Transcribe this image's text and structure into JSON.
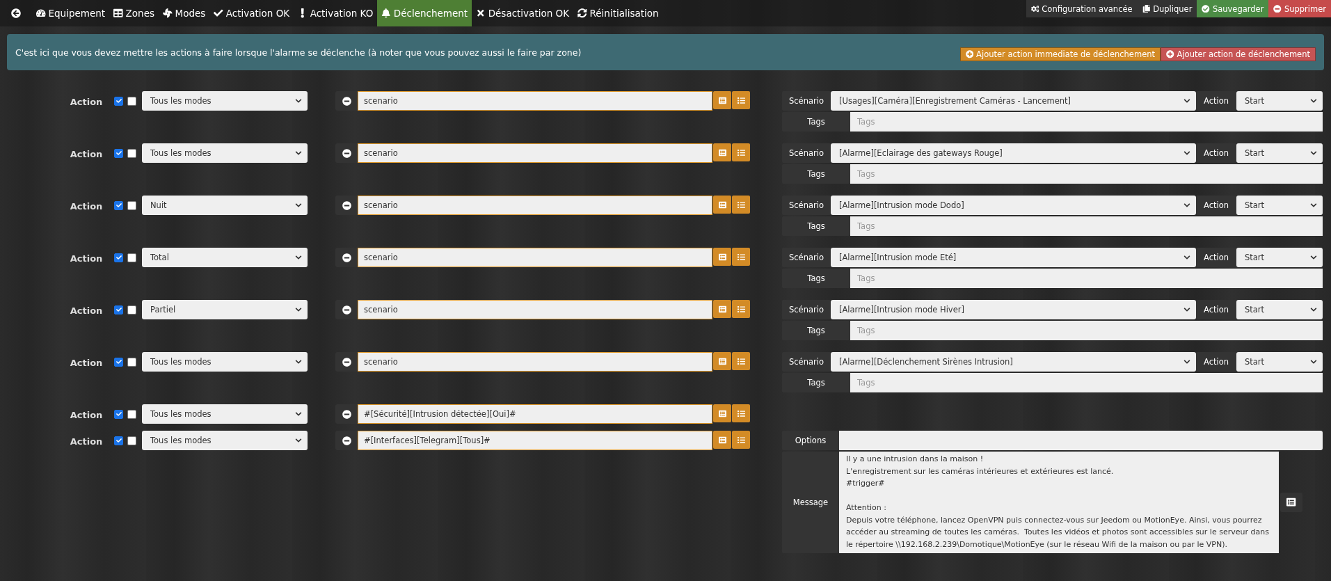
{
  "nav": {
    "tabs": [
      {
        "label": "Equipement",
        "selected": false
      },
      {
        "label": "Zones",
        "selected": false
      },
      {
        "label": "Modes",
        "selected": false
      },
      {
        "label": "Activation OK",
        "selected": false
      },
      {
        "label": "Activation KO",
        "selected": false
      },
      {
        "label": "Déclenchement",
        "selected": true
      },
      {
        "label": "Désactivation OK",
        "selected": false
      },
      {
        "label": "Réinitialisation",
        "selected": false
      }
    ],
    "buttons": [
      {
        "label": "Configuration avancée",
        "kind": "config"
      },
      {
        "label": "Dupliquer",
        "kind": "copy"
      },
      {
        "label": "Sauvegarder",
        "kind": "save"
      },
      {
        "label": "Supprimer",
        "kind": "delete"
      }
    ]
  },
  "info": {
    "text": "C'est ici que vous devez mettre les actions à faire lorsque l'alarme se déclenche (à noter que vous pouvez aussi le faire par zone)",
    "buttons": [
      {
        "label": "Ajouter action immediate de déclenchement",
        "kind": "orange"
      },
      {
        "label": "Ajouter action de déclenchement",
        "kind": "red"
      }
    ]
  },
  "actions": [
    {
      "kind": "scenario",
      "label": "Action",
      "checkboxes": [
        {
          "checked": true
        },
        {
          "checked": false
        }
      ],
      "mode": "Tous les modes",
      "command": "scenario",
      "scenario_label": "Scénario",
      "scenario": "[Usages][Caméra][Enregistrement Caméras - Lancement]",
      "action_label": "Action",
      "action": "Start",
      "tags_label": "Tags",
      "tags_placeholder": "Tags"
    },
    {
      "kind": "scenario",
      "label": "Action",
      "checkboxes": [
        {
          "checked": true
        },
        {
          "checked": false
        }
      ],
      "mode": "Tous les modes",
      "command": "scenario",
      "scenario_label": "Scénario",
      "scenario": "[Alarme][Eclairage des gateways Rouge]",
      "action_label": "Action",
      "action": "Start",
      "tags_label": "Tags",
      "tags_placeholder": "Tags"
    },
    {
      "kind": "scenario",
      "label": "Action",
      "checkboxes": [
        {
          "checked": true
        },
        {
          "checked": false
        }
      ],
      "mode": "Nuit",
      "command": "scenario",
      "scenario_label": "Scénario",
      "scenario": "[Alarme][Intrusion mode Dodo]",
      "action_label": "Action",
      "action": "Start",
      "tags_label": "Tags",
      "tags_placeholder": "Tags"
    },
    {
      "kind": "scenario",
      "label": "Action",
      "checkboxes": [
        {
          "checked": true
        },
        {
          "checked": false
        }
      ],
      "mode": "Total",
      "command": "scenario",
      "scenario_label": "Scénario",
      "scenario": "[Alarme][Intrusion mode Eté]",
      "action_label": "Action",
      "action": "Start",
      "tags_label": "Tags",
      "tags_placeholder": "Tags"
    },
    {
      "kind": "scenario",
      "label": "Action",
      "checkboxes": [
        {
          "checked": true
        },
        {
          "checked": false
        }
      ],
      "mode": "Partiel",
      "command": "scenario",
      "scenario_label": "Scénario",
      "scenario": "[Alarme][Intrusion mode Hiver]",
      "action_label": "Action",
      "action": "Start",
      "tags_label": "Tags",
      "tags_placeholder": "Tags"
    },
    {
      "kind": "scenario",
      "label": "Action",
      "checkboxes": [
        {
          "checked": true
        },
        {
          "checked": false
        }
      ],
      "mode": "Tous les modes",
      "command": "scenario",
      "scenario_label": "Scénario",
      "scenario": "[Alarme][Déclenchement Sirènes Intrusion]",
      "action_label": "Action",
      "action": "Start",
      "tags_label": "Tags",
      "tags_placeholder": "Tags"
    },
    {
      "kind": "plain",
      "label": "Action",
      "checkboxes": [
        {
          "checked": true
        },
        {
          "checked": false
        }
      ],
      "mode": "Tous les modes",
      "command": "#[Sécurité][Intrusion détectée][Oui]#"
    },
    {
      "kind": "message",
      "label": "Action",
      "checkboxes": [
        {
          "checked": true
        },
        {
          "checked": false
        }
      ],
      "mode": "Tous les modes",
      "command": "#[Interfaces][Telegram][Tous]#",
      "options_label": "Options",
      "message_label": "Message",
      "message": "Il y a une intrusion dans la maison !\nL'enregistrement sur les caméras intérieures et extérieures est lancé.\n#trigger#\n\nAttention :\nDepuis votre téléphone, lancez OpenVPN puis connectez-vous sur Jeedom ou MotionEye. Ainsi, vous pourrez accéder au streaming de toutes les caméras.  Toutes les vidéos et photos sont accessibles sur le serveur dans le répertoire \\\\192.168.2.239\\Domotique\\MotionEye (sur le réseau Wifi de la maison ou par le VPN)."
    }
  ]
}
